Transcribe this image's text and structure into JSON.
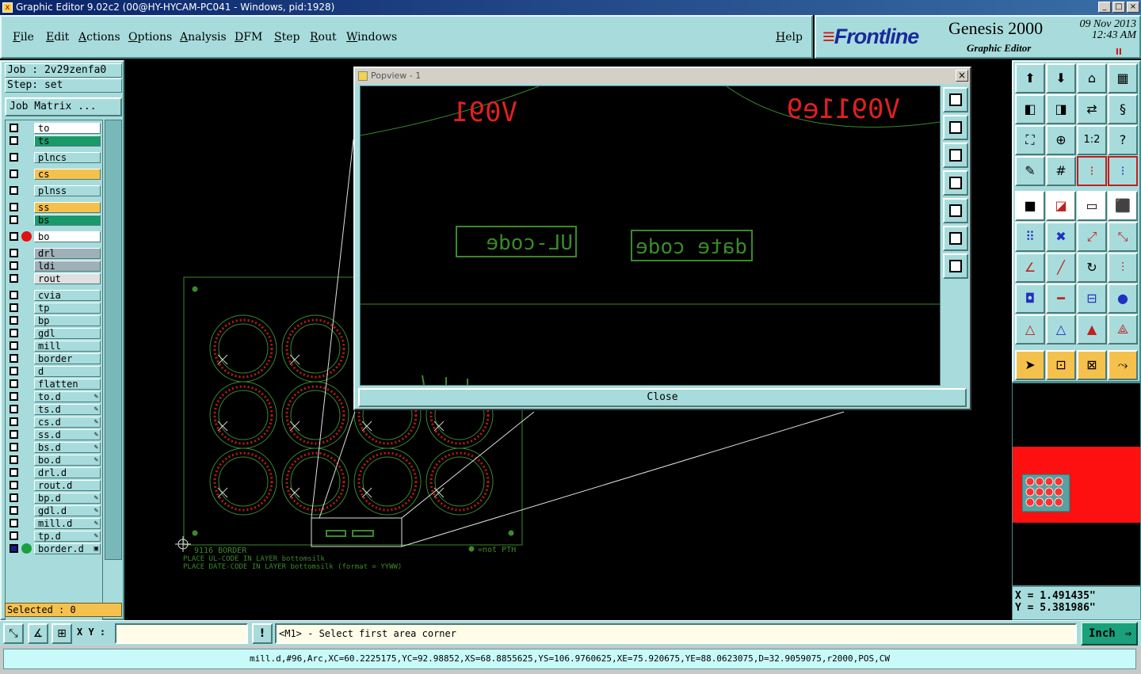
{
  "window": {
    "title": "Graphic Editor 9.02c2 (00@HY-HYCAM-PC041 - Windows, pid:1928)"
  },
  "menu": {
    "file": "File",
    "edit": "Edit",
    "actions": "Actions",
    "options": "Options",
    "analysis": "Analysis",
    "dfm": "DFM",
    "step": "Step",
    "rout": "Rout",
    "windows": "Windows",
    "help": "Help"
  },
  "brand": {
    "logo": "Frontline",
    "product": "Genesis 2000",
    "subtitle": "Graphic Editor",
    "date": "09 Nov 2013",
    "time": "12:43 AM",
    "pause": "II"
  },
  "job": {
    "job_label": "Job : 2v29zenfa0",
    "step_label": "Step: set",
    "matrix_button": "Job Matrix ..."
  },
  "layers": [
    {
      "name": "to",
      "color": "#ffffff",
      "marker": ""
    },
    {
      "name": "ts",
      "color": "#1a9a6a",
      "marker": ""
    },
    {
      "name": "plncs",
      "color": "#a8dcdc",
      "marker": ""
    },
    {
      "name": "cs",
      "color": "#f5c14d",
      "marker": ""
    },
    {
      "name": "plnss",
      "color": "#a8dcdc",
      "marker": ""
    },
    {
      "name": "ss",
      "color": "#f5c14d",
      "marker": ""
    },
    {
      "name": "bs",
      "color": "#1a9a6a",
      "marker": ""
    },
    {
      "name": "bo",
      "color": "#ffffff",
      "marker": "red-dot"
    },
    {
      "name": "drl",
      "color": "#a0b0b8",
      "marker": ""
    },
    {
      "name": "ldi",
      "color": "#a0b0b8",
      "marker": ""
    },
    {
      "name": "rout",
      "color": "#e0e0e0",
      "marker": ""
    },
    {
      "name": "cvia",
      "color": "#a8dcdc",
      "marker": ""
    },
    {
      "name": "tp",
      "color": "#a8dcdc",
      "marker": ""
    },
    {
      "name": "bp",
      "color": "#a8dcdc",
      "marker": ""
    },
    {
      "name": "gdl",
      "color": "#a8dcdc",
      "marker": ""
    },
    {
      "name": "mill",
      "color": "#a8dcdc",
      "marker": ""
    },
    {
      "name": "border",
      "color": "#a8dcdc",
      "marker": ""
    },
    {
      "name": "d",
      "color": "#a8dcdc",
      "marker": ""
    },
    {
      "name": "flatten",
      "color": "#a8dcdc",
      "marker": ""
    },
    {
      "name": "to.d",
      "color": "#a8dcdc",
      "marker": "",
      "edit": true
    },
    {
      "name": "ts.d",
      "color": "#a8dcdc",
      "marker": "",
      "edit": true
    },
    {
      "name": "cs.d",
      "color": "#a8dcdc",
      "marker": "",
      "edit": true
    },
    {
      "name": "ss.d",
      "color": "#a8dcdc",
      "marker": "",
      "edit": true
    },
    {
      "name": "bs.d",
      "color": "#a8dcdc",
      "marker": "",
      "edit": true
    },
    {
      "name": "bo.d",
      "color": "#a8dcdc",
      "marker": "",
      "edit": true
    },
    {
      "name": "drl.d",
      "color": "#a8dcdc",
      "marker": ""
    },
    {
      "name": "rout.d",
      "color": "#a8dcdc",
      "marker": ""
    },
    {
      "name": "bp.d",
      "color": "#a8dcdc",
      "marker": "",
      "edit": true
    },
    {
      "name": "gdl.d",
      "color": "#a8dcdc",
      "marker": "",
      "edit": true
    },
    {
      "name": "mill.d",
      "color": "#a8dcdc",
      "marker": "",
      "edit": true
    },
    {
      "name": "tp.d",
      "color": "#a8dcdc",
      "marker": "",
      "edit": true
    },
    {
      "name": "border.d",
      "color": "#a8dcdc",
      "marker": "green-dot",
      "edit": true,
      "active": true
    }
  ],
  "selected": "Selected : 0",
  "canvas": {
    "annotation1": "9116  BORDER",
    "annotation2": "PLACE UL-CODE IN LAYER bottomsilk",
    "annotation3": "PLACE DATE-CODE IN LAYER bottomsilk (format = YYWW)",
    "not_pth": "=not PTH"
  },
  "popview": {
    "title": "Popview - 1",
    "label_left_top": "V091",
    "label_right_top": "V0911e9",
    "ul_code": "UL-code",
    "date_code": "date code",
    "close": "Close",
    "close_x": "×"
  },
  "coords": {
    "x": "X = 1.491435\"",
    "y": "Y = 5.381986\""
  },
  "command": {
    "xy_label": "X Y :",
    "xy_value": "",
    "bang": "!",
    "message": "<M1> - Select first area corner",
    "unit": "Inch",
    "unit_arrow": "⇒"
  },
  "status": "mill.d,#96,Arc,XC=60.2225175,YC=92.98852,XS=68.8855625,YS=106.9760625,XE=75.920675,YE=88.0623075,D=32.9059075,r2000,POS,CW",
  "colors": {
    "panel": "#a8dcdc",
    "accent_orange": "#f5c14d",
    "accent_green": "#1a9a6a",
    "popview_text": "#3a8a2a",
    "silk_red": "#e02020"
  }
}
